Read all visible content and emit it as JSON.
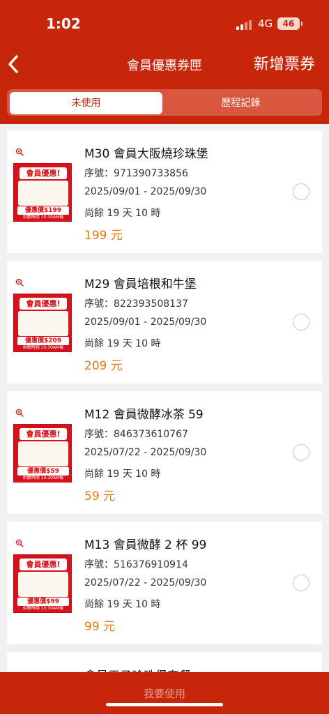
{
  "status": {
    "time": "1:02",
    "network": "4G",
    "battery": "46"
  },
  "header": {
    "title": "會員優惠券匣",
    "add_label": "新增票券"
  },
  "tabs": {
    "unused": "未使用",
    "history": "歷程記錄"
  },
  "thumb_text": {
    "badge": "會員優惠!",
    "price_prefix": "優惠價$",
    "serving_time": "供應時間 10:30AM後"
  },
  "coupons": [
    {
      "name": "M30 會員大阪燒珍珠堡",
      "serial": "序號：971390733856",
      "period": "2025/09/01 - 2025/09/30",
      "remaining": "尚餘 19 天 10 時",
      "price": "199 元",
      "thumb_price": "199"
    },
    {
      "name": "M29 會員培根和牛堡",
      "serial": "序號：822393508137",
      "period": "2025/09/01 - 2025/09/30",
      "remaining": "尚餘 19 天 10 時",
      "price": "209 元",
      "thumb_price": "209"
    },
    {
      "name": "M12 會員微酵冰茶 59",
      "serial": "序號：846373610767",
      "period": "2025/07/22 - 2025/09/30",
      "remaining": "尚餘 19 天 10 時",
      "price": "59 元",
      "thumb_price": "59"
    },
    {
      "name": "M13 會員微酵 2 杯 99",
      "serial": "序號：516376910914",
      "period": "2025/07/22 - 2025/09/30",
      "remaining": "尚餘 19 天 10 時",
      "price": "99 元",
      "thumb_price": "99"
    }
  ],
  "partial_coupon": {
    "name": "會員王子珍珠堡套餐"
  },
  "bottom": {
    "use_label": "我要使用"
  },
  "colors": {
    "brand": "#c8260b",
    "price": "#e07b0e"
  }
}
